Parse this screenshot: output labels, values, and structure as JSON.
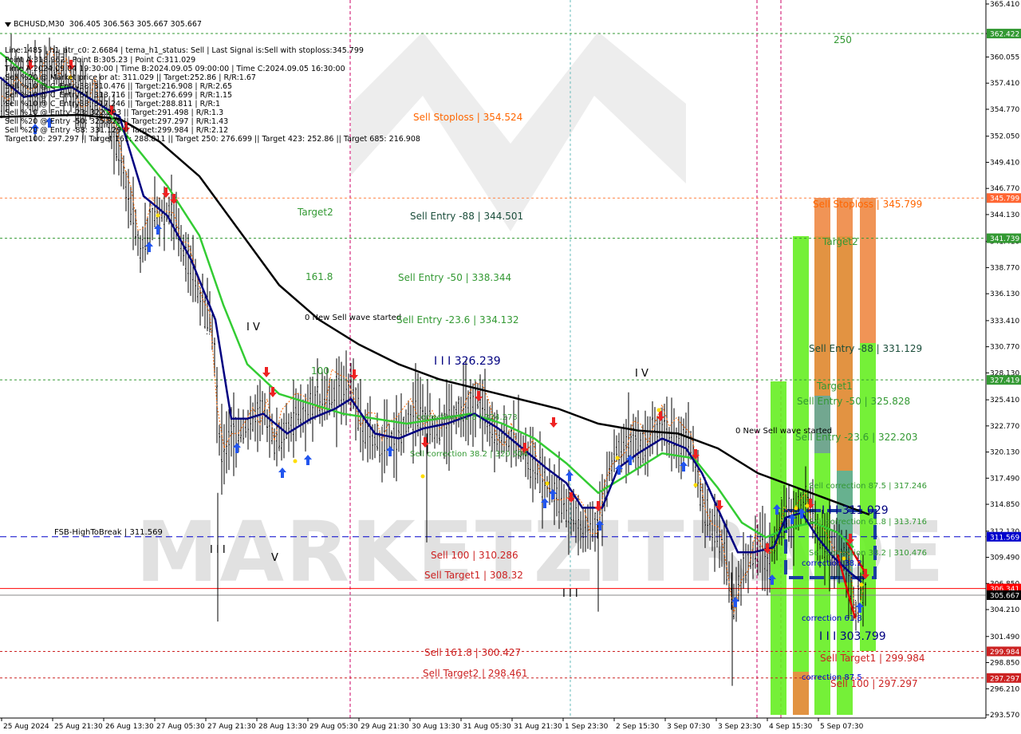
{
  "header": {
    "symbol_line": "BCHUSD,M30  306.405 306.563 305.667 305.667",
    "info_lines": [
      "Line:1485 | h1_atr_c0: 2.6684 | tema_h1_status: Sell | Last Signal is:Sell with stoploss:345.799",
      "Point A:318.962 | Point B:305.23 | Point C:311.029",
      "Time A:2024.09.04 19:30:00 | Time B:2024.09.05 09:00:00 | Time C:2024.09.05 16:30:00",
      "Sell %20 @ Market price or at: 311.029 || Target:252.86 | R/R:1.67",
      "Sell %10 @ C_Entry38: 310.476 || Target:216.908 | R/R:2.65",
      "Sell %10 @ C_Entry61: 313.716 || Target:276.699 | R/R:1.15",
      "Sell %10 @ C_Entry88: 317.246 || Target:288.811 | R/R:1",
      "Sell %10 @ Entry -23: 322.203 || Target:291.498 | R/R:1.3",
      "Sell %20 @ Entry -50: 325.828 || Target:297.297 | R/R:1.43",
      "Sell %20 @ Entry -88: 331.129 || Target:299.984 | R/R:2.12",
      "Target100: 297.297 || Target 161: 288.811 || Target 250: 276.699 || Target 423: 252.86 || Target 685: 216.908"
    ]
  },
  "watermark": {
    "text": "MARKETZITRADE"
  },
  "colors": {
    "candle": "#000000",
    "ma_black": "#000000",
    "ma_green": "#33cc33",
    "ma_blue": "#000080",
    "orange_dotted": "#ff6600",
    "red_line": "#ff0000",
    "blue_dashed": "#0000cc",
    "green_dashed": "#339933",
    "orange_dashed": "#ff8040",
    "magenta": "#cc0066",
    "cyan": "#66bbbb",
    "bar_green": "#66ee22",
    "bar_orange": "#ee8844",
    "bar_teal": "#66aa99"
  },
  "axis": {
    "y_ticks": [
      "365.410",
      "362.422",
      "360.055",
      "357.410",
      "354.770",
      "352.050",
      "349.410",
      "346.770",
      "344.130",
      "341.410",
      "338.770",
      "336.130",
      "333.410",
      "330.770",
      "328.130",
      "325.410",
      "322.770",
      "320.130",
      "317.490",
      "314.850",
      "312.130",
      "309.490",
      "306.850",
      "304.210",
      "301.490",
      "298.850",
      "296.210",
      "293.570"
    ],
    "x_ticks": [
      "25 Aug 2024",
      "25 Aug 21:30",
      "26 Aug 13:30",
      "27 Aug 05:30",
      "27 Aug 21:30",
      "28 Aug 13:30",
      "29 Aug 05:30",
      "29 Aug 21:30",
      "30 Aug 13:30",
      "31 Aug 05:30",
      "31 Aug 21:30",
      "1 Sep 23:30",
      "2 Sep 15:30",
      "3 Sep 07:30",
      "3 Sep 23:30",
      "4 Sep 15:30",
      "5 Sep 07:30"
    ]
  },
  "price_tags": [
    {
      "text": "362.422",
      "price": 362.422,
      "color": "#339933"
    },
    {
      "text": "345.799",
      "price": 345.799,
      "color": "#ff6633"
    },
    {
      "text": "341.739",
      "price": 341.739,
      "color": "#339933"
    },
    {
      "text": "327.419",
      "price": 327.419,
      "color": "#339933"
    },
    {
      "text": "311.569",
      "price": 311.569,
      "color": "#0000cc"
    },
    {
      "text": "306.341",
      "price": 306.341,
      "color": "#ff0000"
    },
    {
      "text": "305.667",
      "price": 305.667,
      "color": "#000000"
    },
    {
      "text": "299.984",
      "price": 299.984,
      "color": "#cc2222"
    },
    {
      "text": "297.297",
      "price": 297.297,
      "color": "#cc2222"
    }
  ],
  "labels": {
    "fsb": "FSB-HighToBreak | 311.569",
    "sell_stoploss_left": "Sell Stoploss | 354.524",
    "target2": "Target2",
    "sell_entry_88_left": "Sell Entry -88 | 344.501",
    "fib_1618": "161.8",
    "sell_entry_50_left": "Sell Entry -50 | 338.344",
    "new_wave_left": "0 New Sell wave started",
    "sell_entry_236_left": "Sell Entry -23.6 | 334.132",
    "wave_iv_left": "I V",
    "fib_100": "100",
    "wave_iii_326": "I I I 326.239",
    "correction_left_618": "correction 61.8 | 324.273",
    "correction_left_382": "Sell correction 38.2 | 320.504",
    "wave_iii_low": "I I I",
    "wave_v": "V",
    "sell_100_left": "Sell 100 | 310.286",
    "sell_target1_left": "Sell Target1 | 308.32",
    "wave_iii_mid": "I I I",
    "sell_1618": "Sell 161.8 | 300.427",
    "sell_target2": "Sell Target2 | 298.461",
    "wave_iv_right": "I V",
    "new_wave_right": "0 New Sell wave started",
    "fib_250": "250",
    "sell_stoploss_right": "Sell Stoploss | 345.799",
    "target_right_top": "Target2",
    "sell_entry_88_right": "Sell Entry -88 | 331.129",
    "target_right_mid": "Target1",
    "sell_entry_50_right": "Sell Entry -50 | 325.828",
    "sell_entry_236_right": "Sell Entry -23.6 | 322.203",
    "sell_corr_875": "Sell correction 87.5 | 317.246",
    "wave_iii_right": "I I I 311.029",
    "sell_corr_618": "Sell correction 61.8 | 313.716",
    "sell_corr_382": "Sell correction 38.2 | 310.476",
    "correction_382_small": "correction 38.2",
    "correction_618_small": "correction 61.8",
    "wave_iii_303": "I I I 303.799",
    "sell_target1_right": "Sell Target1 | 299.984",
    "correction_875_small": "correction 87.5",
    "sell_100_right": "Sell 100 | 297.297"
  },
  "chart_data": {
    "type": "candlestick",
    "symbol": "BCHUSD",
    "timeframe": "M30",
    "ylim": [
      293.57,
      365.41
    ],
    "last_price": 305.667,
    "price_path": [
      [
        0,
        355.0
      ],
      [
        20,
        358.0
      ],
      [
        45,
        356.5
      ],
      [
        70,
        359.5
      ],
      [
        95,
        356.0
      ],
      [
        120,
        355.5
      ],
      [
        140,
        353.5
      ],
      [
        160,
        346.0
      ],
      [
        175,
        340.5
      ],
      [
        190,
        344.0
      ],
      [
        215,
        344.5
      ],
      [
        235,
        339.5
      ],
      [
        255,
        335.0
      ],
      [
        268,
        332.0
      ],
      [
        276,
        320.0
      ],
      [
        290,
        322.0
      ],
      [
        310,
        322.5
      ],
      [
        330,
        324.5
      ],
      [
        345,
        321.0
      ],
      [
        370,
        323.5
      ],
      [
        395,
        325.0
      ],
      [
        420,
        326.0
      ],
      [
        440,
        327.0
      ],
      [
        455,
        322.0
      ],
      [
        480,
        321.0
      ],
      [
        500,
        322.0
      ],
      [
        520,
        324.0
      ],
      [
        545,
        322.5
      ],
      [
        570,
        324.0
      ],
      [
        598,
        325.5
      ],
      [
        620,
        322.0
      ],
      [
        650,
        321.0
      ],
      [
        670,
        318.5
      ],
      [
        690,
        316.5
      ],
      [
        710,
        314.5
      ],
      [
        730,
        312.5
      ],
      [
        750,
        313.0
      ],
      [
        770,
        320.0
      ],
      [
        790,
        321.0
      ],
      [
        810,
        321.0
      ],
      [
        830,
        323.0
      ],
      [
        845,
        321.0
      ],
      [
        865,
        321.0
      ],
      [
        880,
        315.0
      ],
      [
        895,
        312.5
      ],
      [
        910,
        309.5
      ],
      [
        920,
        304.5
      ],
      [
        935,
        309.0
      ],
      [
        955,
        310.5
      ],
      [
        965,
        309.0
      ],
      [
        980,
        314.0
      ],
      [
        995,
        314.0
      ],
      [
        1010,
        316.0
      ],
      [
        1025,
        312.0
      ],
      [
        1045,
        310.0
      ],
      [
        1060,
        309.5
      ],
      [
        1072,
        304.0
      ],
      [
        1080,
        306.4
      ],
      [
        1085,
        305.667
      ]
    ],
    "series": [
      {
        "name": "MA black",
        "points": [
          [
            0,
            354.0
          ],
          [
            100,
            354.2
          ],
          [
            150,
            353.8
          ],
          [
            200,
            351.5
          ],
          [
            250,
            348.0
          ],
          [
            300,
            342.5
          ],
          [
            350,
            337.0
          ],
          [
            400,
            333.5
          ],
          [
            450,
            331.0
          ],
          [
            500,
            329.0
          ],
          [
            550,
            327.5
          ],
          [
            600,
            326.5
          ],
          [
            650,
            325.5
          ],
          [
            700,
            324.5
          ],
          [
            750,
            323.0
          ],
          [
            800,
            322.3
          ],
          [
            850,
            322.0
          ],
          [
            900,
            320.5
          ],
          [
            950,
            318.0
          ],
          [
            1000,
            316.5
          ],
          [
            1050,
            315.0
          ],
          [
            1090,
            313.8
          ]
        ]
      },
      {
        "name": "MA green",
        "points": [
          [
            0,
            360.5
          ],
          [
            30,
            358.5
          ],
          [
            60,
            357.0
          ],
          [
            90,
            357.0
          ],
          [
            130,
            355.0
          ],
          [
            170,
            351.0
          ],
          [
            210,
            347.0
          ],
          [
            250,
            342.0
          ],
          [
            280,
            335.0
          ],
          [
            310,
            329.0
          ],
          [
            350,
            326.0
          ],
          [
            390,
            325.0
          ],
          [
            430,
            324.0
          ],
          [
            470,
            323.5
          ],
          [
            510,
            323.0
          ],
          [
            550,
            323.5
          ],
          [
            590,
            324.0
          ],
          [
            630,
            323.0
          ],
          [
            670,
            321.5
          ],
          [
            710,
            319.0
          ],
          [
            750,
            316.0
          ],
          [
            790,
            318.0
          ],
          [
            830,
            320.0
          ],
          [
            870,
            319.5
          ],
          [
            900,
            316.5
          ],
          [
            930,
            313.0
          ],
          [
            960,
            311.5
          ],
          [
            990,
            312.5
          ],
          [
            1020,
            313.0
          ],
          [
            1050,
            312.0
          ],
          [
            1070,
            310.5
          ]
        ]
      },
      {
        "name": "MA blue",
        "points": [
          [
            0,
            358.0
          ],
          [
            30,
            356.0
          ],
          [
            60,
            356.5
          ],
          [
            90,
            357.0
          ],
          [
            120,
            355.5
          ],
          [
            150,
            354.0
          ],
          [
            180,
            346.0
          ],
          [
            210,
            344.0
          ],
          [
            240,
            339.5
          ],
          [
            270,
            333.5
          ],
          [
            290,
            323.5
          ],
          [
            310,
            323.5
          ],
          [
            330,
            324.0
          ],
          [
            360,
            322.0
          ],
          [
            390,
            323.5
          ],
          [
            420,
            324.5
          ],
          [
            440,
            325.5
          ],
          [
            470,
            322.0
          ],
          [
            500,
            321.5
          ],
          [
            530,
            322.5
          ],
          [
            560,
            323.0
          ],
          [
            595,
            324.0
          ],
          [
            625,
            322.5
          ],
          [
            655,
            320.5
          ],
          [
            685,
            318.5
          ],
          [
            710,
            317.0
          ],
          [
            730,
            314.5
          ],
          [
            755,
            314.5
          ],
          [
            775,
            318.5
          ],
          [
            800,
            320.0
          ],
          [
            830,
            321.5
          ],
          [
            860,
            320.5
          ],
          [
            880,
            318.0
          ],
          [
            905,
            313.5
          ],
          [
            925,
            310.0
          ],
          [
            945,
            310.0
          ],
          [
            970,
            310.5
          ],
          [
            985,
            313.5
          ],
          [
            1005,
            314.0
          ],
          [
            1025,
            311.5
          ],
          [
            1045,
            309.5
          ],
          [
            1065,
            308.0
          ],
          [
            1080,
            307.0
          ]
        ]
      }
    ],
    "rectangles_note": "Vertical green/orange zone bars and horizontal level lines as shown"
  }
}
